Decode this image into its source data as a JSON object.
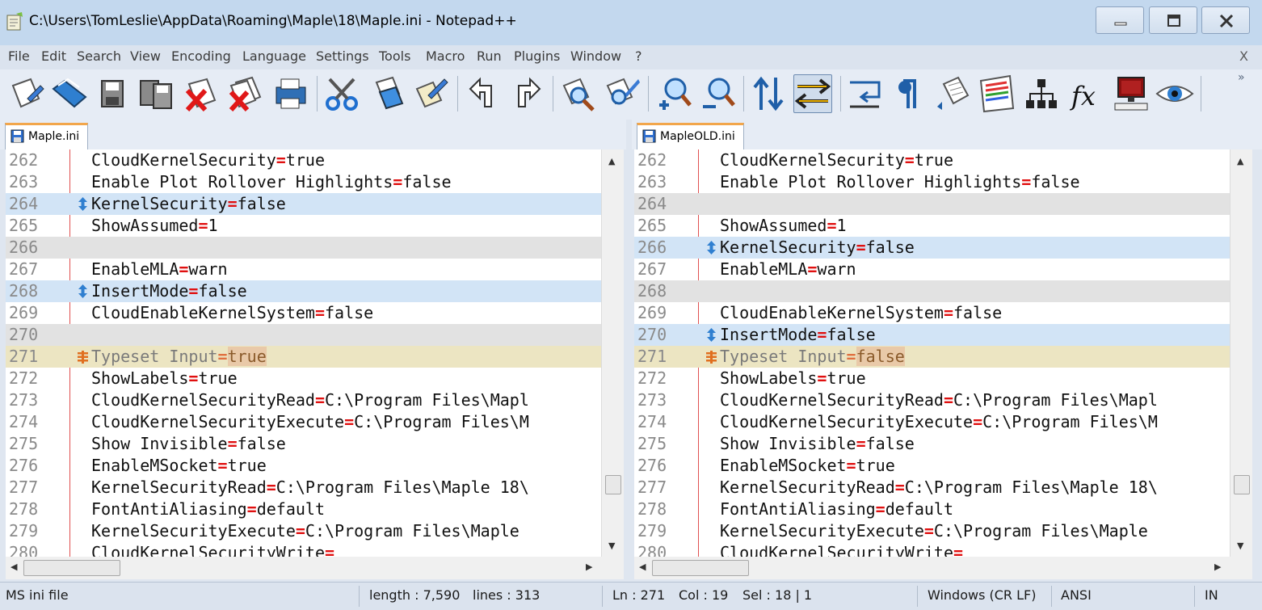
{
  "window": {
    "title": "C:\\Users\\TomLeslie\\AppData\\Roaming\\Maple\\18\\Maple.ini - Notepad++"
  },
  "menu": {
    "items": [
      "File",
      "Edit",
      "Search",
      "View",
      "Encoding",
      "Language",
      "Settings",
      "Tools",
      "Macro",
      "Run",
      "Plugins",
      "Window",
      "?"
    ],
    "close_label": "X"
  },
  "toolbar": {
    "chevron": "»",
    "icons": [
      "new-file-icon",
      "open-file-icon",
      "save-icon",
      "save-all-icon",
      "close-icon",
      "close-all-icon",
      "print-icon",
      "cut-icon",
      "copy-icon",
      "paste-icon",
      "undo-icon",
      "redo-icon",
      "find-icon",
      "replace-icon",
      "zoom-in-icon",
      "zoom-out-icon",
      "sync-vertical-icon",
      "sync-horizontal-icon",
      "word-wrap-icon",
      "show-all-chars-icon",
      "indent-guide-icon",
      "doc-map-icon",
      "function-list-icon",
      "fx-icon",
      "monitoring-icon",
      "eye-icon"
    ]
  },
  "tabs": {
    "left": "Maple.ini",
    "right": "MapleOLD.ini"
  },
  "left_pane": {
    "rows": [
      {
        "ln": "262",
        "state": "normal",
        "key": "CloudKernelSecurity",
        "value": "true"
      },
      {
        "ln": "263",
        "state": "normal",
        "key": "Enable Plot Rollover Highlights",
        "value": "false"
      },
      {
        "ln": "264",
        "state": "changed",
        "key": "KernelSecurity",
        "value": "false"
      },
      {
        "ln": "265",
        "state": "normal",
        "key": "ShowAssumed",
        "value": "1"
      },
      {
        "ln": "266",
        "state": "blank",
        "key": "",
        "value": ""
      },
      {
        "ln": "267",
        "state": "normal",
        "key": "EnableMLA",
        "value": "warn"
      },
      {
        "ln": "268",
        "state": "changed",
        "key": "InsertMode",
        "value": "false"
      },
      {
        "ln": "269",
        "state": "normal",
        "key": "CloudEnableKernelSystem",
        "value": "false"
      },
      {
        "ln": "270",
        "state": "blank",
        "key": "",
        "value": ""
      },
      {
        "ln": "271",
        "state": "modified",
        "key": "Typeset Input",
        "value": "true"
      },
      {
        "ln": "272",
        "state": "normal",
        "key": "ShowLabels",
        "value": "true"
      },
      {
        "ln": "273",
        "state": "normal",
        "key": "CloudKernelSecurityRead",
        "value": "C:\\Program Files\\Mapl"
      },
      {
        "ln": "274",
        "state": "normal",
        "key": "CloudKernelSecurityExecute",
        "value": "C:\\Program Files\\M"
      },
      {
        "ln": "275",
        "state": "normal",
        "key": "Show Invisible",
        "value": "false"
      },
      {
        "ln": "276",
        "state": "normal",
        "key": "EnableMSocket",
        "value": "true"
      },
      {
        "ln": "277",
        "state": "normal",
        "key": "KernelSecurityRead",
        "value": "C:\\Program Files\\Maple 18\\"
      },
      {
        "ln": "278",
        "state": "normal",
        "key": "FontAntiAliasing",
        "value": "default"
      },
      {
        "ln": "279",
        "state": "normal",
        "key": "KernelSecurityExecute",
        "value": "C:\\Program Files\\Maple "
      },
      {
        "ln": "280",
        "state": "normal",
        "key": "CloudKernelSecurityWrite",
        "value": ""
      }
    ]
  },
  "right_pane": {
    "rows": [
      {
        "ln": "262",
        "state": "normal",
        "key": "CloudKernelSecurity",
        "value": "true"
      },
      {
        "ln": "263",
        "state": "normal",
        "key": "Enable Plot Rollover Highlights",
        "value": "false"
      },
      {
        "ln": "264",
        "state": "blank",
        "key": "",
        "value": ""
      },
      {
        "ln": "265",
        "state": "normal",
        "key": "ShowAssumed",
        "value": "1"
      },
      {
        "ln": "266",
        "state": "changed",
        "key": "KernelSecurity",
        "value": "false"
      },
      {
        "ln": "267",
        "state": "normal",
        "key": "EnableMLA",
        "value": "warn"
      },
      {
        "ln": "268",
        "state": "blank",
        "key": "",
        "value": ""
      },
      {
        "ln": "269",
        "state": "normal",
        "key": "CloudEnableKernelSystem",
        "value": "false"
      },
      {
        "ln": "270",
        "state": "changed",
        "key": "InsertMode",
        "value": "false"
      },
      {
        "ln": "271",
        "state": "modified",
        "key": "Typeset Input",
        "value": "false"
      },
      {
        "ln": "272",
        "state": "normal",
        "key": "ShowLabels",
        "value": "true"
      },
      {
        "ln": "273",
        "state": "normal",
        "key": "CloudKernelSecurityRead",
        "value": "C:\\Program Files\\Mapl"
      },
      {
        "ln": "274",
        "state": "normal",
        "key": "CloudKernelSecurityExecute",
        "value": "C:\\Program Files\\M"
      },
      {
        "ln": "275",
        "state": "normal",
        "key": "Show Invisible",
        "value": "false"
      },
      {
        "ln": "276",
        "state": "normal",
        "key": "EnableMSocket",
        "value": "true"
      },
      {
        "ln": "277",
        "state": "normal",
        "key": "KernelSecurityRead",
        "value": "C:\\Program Files\\Maple 18\\"
      },
      {
        "ln": "278",
        "state": "normal",
        "key": "FontAntiAliasing",
        "value": "default"
      },
      {
        "ln": "279",
        "state": "normal",
        "key": "KernelSecurityExecute",
        "value": "C:\\Program Files\\Maple "
      },
      {
        "ln": "280",
        "state": "normal",
        "key": "CloudKernelSecurityWrite",
        "value": ""
      }
    ]
  },
  "status": {
    "file_type": "MS ini file",
    "length": "length : 7,590",
    "lines": "lines : 313",
    "ln": "Ln : 271",
    "col": "Col : 19",
    "sel": "Sel : 18 | 1",
    "eol": "Windows (CR LF)",
    "encoding": "ANSI",
    "mode": "IN"
  },
  "colors": {
    "changed_row": "#d2e4f6",
    "blank_row": "#e2e2e2",
    "modified_row": "#ece5c2",
    "operator": "#e01010"
  }
}
